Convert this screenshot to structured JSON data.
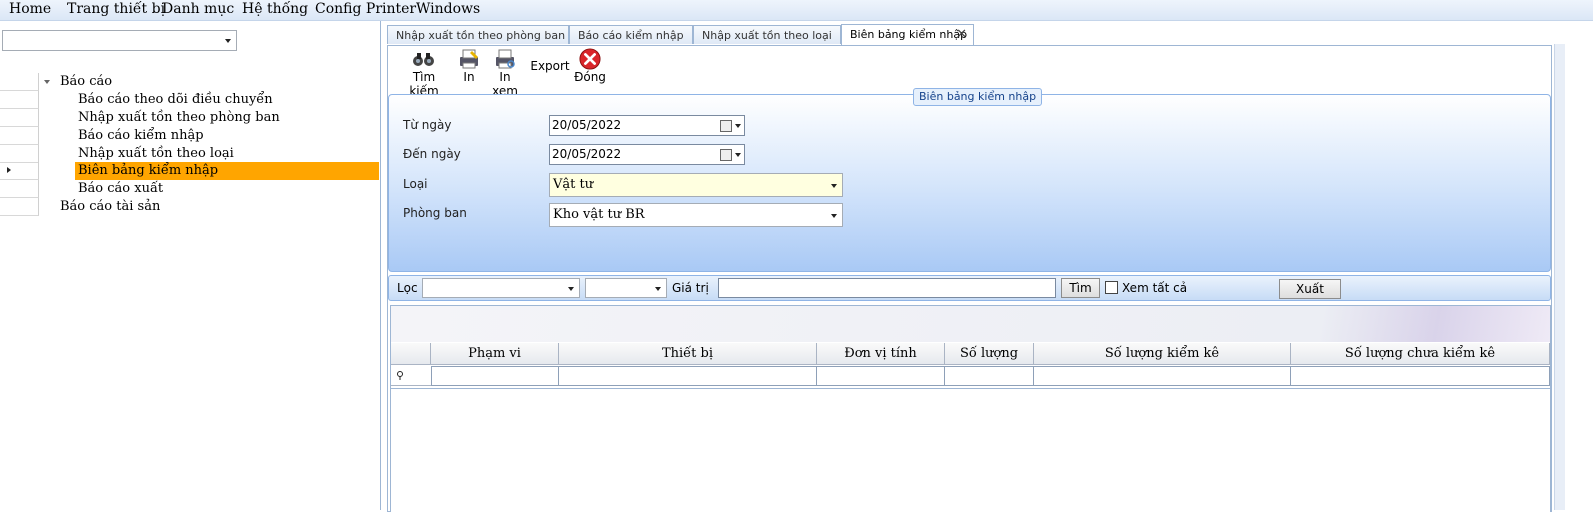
{
  "menu": {
    "items": [
      "Home",
      "Trang thiết bị",
      "Danh mục",
      "Hệ thống",
      "Config Printer",
      "Windows"
    ]
  },
  "sidebar": {
    "combo_value": "",
    "tree": {
      "root_label": "Báo cáo",
      "children": [
        "Báo cáo theo dõi điều chuyển",
        "Nhập xuất tồn theo phòng ban",
        "Báo cáo kiểm nhập",
        "Nhập xuất tồn theo loại",
        "Biên bảng kiểm nhập",
        "Báo cáo xuất"
      ],
      "selected_index": 4,
      "sibling_label": "Báo cáo tài sản"
    },
    "selected_color": "#ffa500"
  },
  "tabs": [
    {
      "label": "Nhập xuất tồn theo phòng ban"
    },
    {
      "label": "Báo cáo kiểm nhập"
    },
    {
      "label": "Nhập xuất tồn theo loại"
    },
    {
      "label": "Biên bảng kiểm nhập",
      "active": true
    }
  ],
  "toolbar": {
    "search_label": "Tìm kiếm",
    "print_label": "In",
    "print_preview_label": "In xem",
    "export_label": "Export",
    "close_label": "Đóng"
  },
  "form": {
    "group_title": "Biên bảng kiểm nhập",
    "from_date_label": "Từ ngày",
    "from_date_value": "20/05/2022",
    "to_date_label": "Đến ngày",
    "to_date_value": "20/05/2022",
    "type_label": "Loại",
    "type_value": "Vật tư",
    "department_label": "Phòng ban",
    "department_value": "Kho vật tư BR"
  },
  "filter": {
    "filter_label": "Lọc",
    "filter_field_value": "",
    "filter_op_value": "",
    "value_label": "Giá trị",
    "value_input": "",
    "find_button": "Tìm",
    "show_all_label": "Xem tất cả",
    "show_all_checked": false,
    "export_button": "Xuất"
  },
  "grid": {
    "group_panel_hint": "",
    "columns": [
      "Phạm vi",
      "Thiết bị",
      "Đơn vị tính",
      "Số lượng",
      "Số lượng kiểm kê",
      "Số lượng chưa kiểm kê"
    ],
    "rows": []
  }
}
